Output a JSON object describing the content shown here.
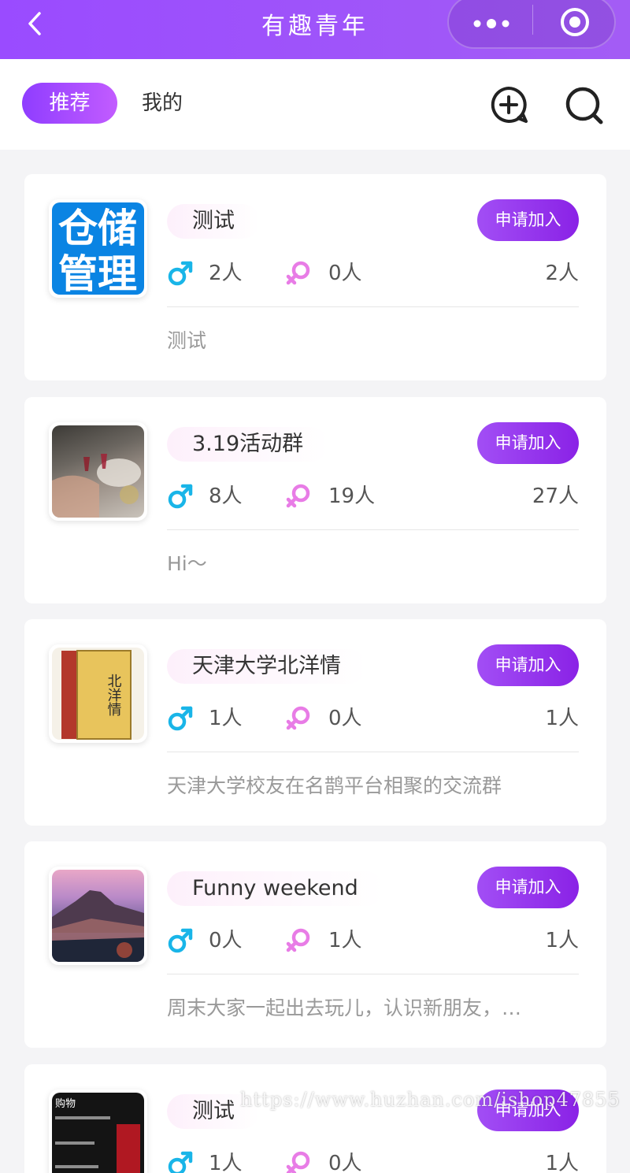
{
  "header": {
    "title": "有趣青年"
  },
  "tabs": {
    "active": "推荐",
    "other": "我的"
  },
  "thumb_text": {
    "card1": "仓储管理",
    "card3": "北洋情",
    "card5": "购物"
  },
  "groups": [
    {
      "name": "测试",
      "join_label": "申请加入",
      "male": "2人",
      "female": "0人",
      "total": "2人",
      "desc": "测试"
    },
    {
      "name": "3.19活动群",
      "join_label": "申请加入",
      "male": "8人",
      "female": "19人",
      "total": "27人",
      "desc": "Hi～"
    },
    {
      "name": "天津大学北洋情",
      "join_label": "申请加入",
      "male": "1人",
      "female": "0人",
      "total": "1人",
      "desc": "天津大学校友在名鹊平台相聚的交流群"
    },
    {
      "name": "Funny weekend",
      "join_label": "申请加入",
      "male": "0人",
      "female": "1人",
      "total": "1人",
      "desc": "周末大家一起出去玩儿，认识新朋友，…"
    },
    {
      "name": "测试",
      "join_label": "申请加入",
      "male": "1人",
      "female": "0人",
      "total": "1人",
      "desc": ""
    }
  ],
  "watermark": "https://www.huzhan.com/ishop47855",
  "colors": {
    "accent": "#9a4bff",
    "male": "#19b5e8",
    "female": "#e87ce6"
  }
}
